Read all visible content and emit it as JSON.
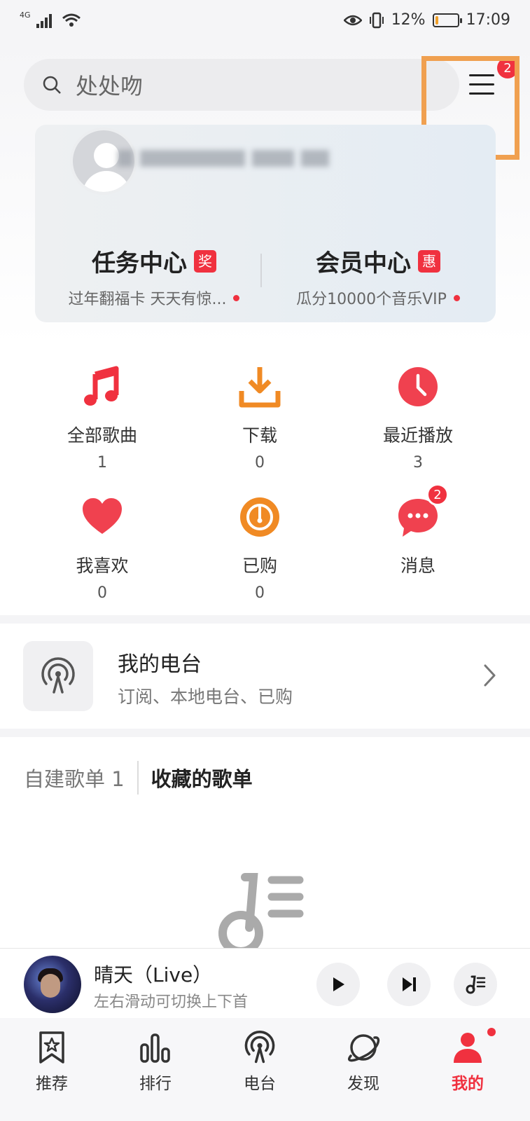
{
  "status_bar": {
    "network": "4G",
    "battery_percent": "12%",
    "time": "17:09",
    "battery_level": 0.12
  },
  "search": {
    "placeholder": "处处吻"
  },
  "menu": {
    "badge": "2"
  },
  "profile": {
    "task_center": {
      "title": "任务中心",
      "tag": "奖",
      "subtitle": "过年翻福卡 天天有惊..."
    },
    "member_center": {
      "title": "会员中心",
      "tag": "惠",
      "subtitle": "瓜分10000个音乐VIP"
    }
  },
  "grid": [
    {
      "label": "全部歌曲",
      "count": "1",
      "icon": "music-note-icon"
    },
    {
      "label": "下载",
      "count": "0",
      "icon": "download-icon"
    },
    {
      "label": "最近播放",
      "count": "3",
      "icon": "clock-icon"
    },
    {
      "label": "我喜欢",
      "count": "0",
      "icon": "heart-icon"
    },
    {
      "label": "已购",
      "count": "0",
      "icon": "purchased-disc-icon"
    },
    {
      "label": "消息",
      "count": "",
      "icon": "message-icon",
      "badge": "2"
    }
  ],
  "radio": {
    "title": "我的电台",
    "subtitle": "订阅、本地电台、已购"
  },
  "playlists": {
    "tab_created": "自建歌单 1",
    "tab_collected": "收藏的歌单"
  },
  "player": {
    "song_title": "晴天（Live）",
    "hint": "左右滑动可切换上下首"
  },
  "nav": [
    {
      "label": "推荐",
      "icon": "star-bookmark-icon"
    },
    {
      "label": "排行",
      "icon": "chart-bars-icon"
    },
    {
      "label": "电台",
      "icon": "radio-tower-icon"
    },
    {
      "label": "发现",
      "icon": "planet-icon"
    },
    {
      "label": "我的",
      "icon": "person-icon",
      "active": true
    }
  ],
  "colors": {
    "accent_red": "#f0313f",
    "download_orange": "#f08a24",
    "highlight_orange": "#f0a050"
  }
}
